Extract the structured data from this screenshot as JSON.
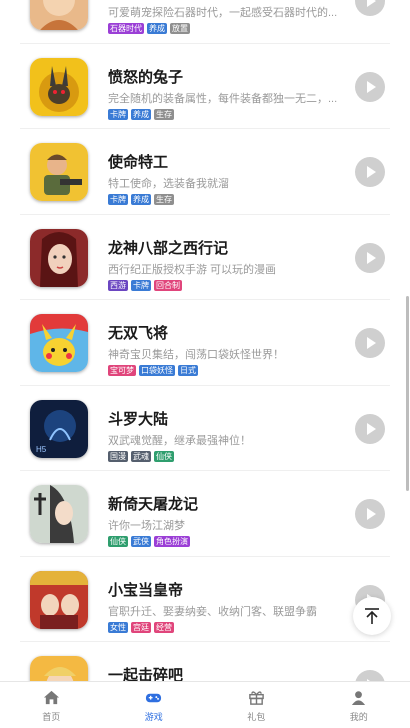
{
  "games": [
    {
      "title": "",
      "desc": "可爱萌宠探险石器时代，一起感受石器时代的...",
      "tags": [
        {
          "label": "石器时代",
          "color": "#9b3fd6"
        },
        {
          "label": "养成",
          "color": "#3a7bd5"
        },
        {
          "label": "放置",
          "color": "#8f8f8f"
        }
      ]
    },
    {
      "title": "愤怒的兔子",
      "desc": "完全随机的装备属性，每件装备都独一无二，...",
      "tags": [
        {
          "label": "卡牌",
          "color": "#3a7bd5"
        },
        {
          "label": "养成",
          "color": "#3a7bd5"
        },
        {
          "label": "生存",
          "color": "#8f8f8f"
        }
      ]
    },
    {
      "title": "使命特工",
      "desc": "特工使命，选装备我就溜",
      "tags": [
        {
          "label": "卡牌",
          "color": "#3a7bd5"
        },
        {
          "label": "养成",
          "color": "#3a7bd5"
        },
        {
          "label": "生存",
          "color": "#8f8f8f"
        }
      ]
    },
    {
      "title": "龙神八部之西行记",
      "desc": "西行纪正版授权手游 可以玩的漫画",
      "tags": [
        {
          "label": "西游",
          "color": "#6b46c1"
        },
        {
          "label": "卡牌",
          "color": "#3a7bd5"
        },
        {
          "label": "回合制",
          "color": "#e0457b"
        }
      ]
    },
    {
      "title": "无双飞将",
      "desc": "神奇宝贝集结，闯荡口袋妖怪世界！",
      "tags": [
        {
          "label": "宝可梦",
          "color": "#e0457b"
        },
        {
          "label": "口袋妖怪",
          "color": "#3a7bd5"
        },
        {
          "label": "日式",
          "color": "#3a7bd5"
        }
      ]
    },
    {
      "title": "斗罗大陆",
      "desc": "双武魂觉醒，继承最强神位！",
      "tags": [
        {
          "label": "国漫",
          "color": "#555f6e"
        },
        {
          "label": "武魂",
          "color": "#555f6e"
        },
        {
          "label": "仙侠",
          "color": "#2f9e6e"
        }
      ]
    },
    {
      "title": "新倚天屠龙记",
      "desc": "许你一场江湖梦",
      "tags": [
        {
          "label": "仙侠",
          "color": "#2f9e6e"
        },
        {
          "label": "武侠",
          "color": "#3a7bd5"
        },
        {
          "label": "角色扮演",
          "color": "#9b3fd6"
        }
      ]
    },
    {
      "title": "小宝当皇帝",
      "desc": "官职升迁、娶妻纳妾、收纳门客、联盟争霸",
      "tags": [
        {
          "label": "女性",
          "color": "#3a7bd5"
        },
        {
          "label": "宫廷",
          "color": "#e0457b"
        },
        {
          "label": "经营",
          "color": "#e0457b"
        }
      ]
    },
    {
      "title": "一起击碎吧",
      "desc": "",
      "tags": []
    }
  ],
  "tabbar": [
    {
      "label": "首页",
      "icon": "home-icon"
    },
    {
      "label": "游戏",
      "icon": "gamepad-icon"
    },
    {
      "label": "礼包",
      "icon": "gift-icon"
    },
    {
      "label": "我的",
      "icon": "user-icon"
    }
  ],
  "colors": {
    "accent": "#2f6fe0",
    "play_button": "#cfcfcf",
    "inactive_tab": "#888888"
  }
}
